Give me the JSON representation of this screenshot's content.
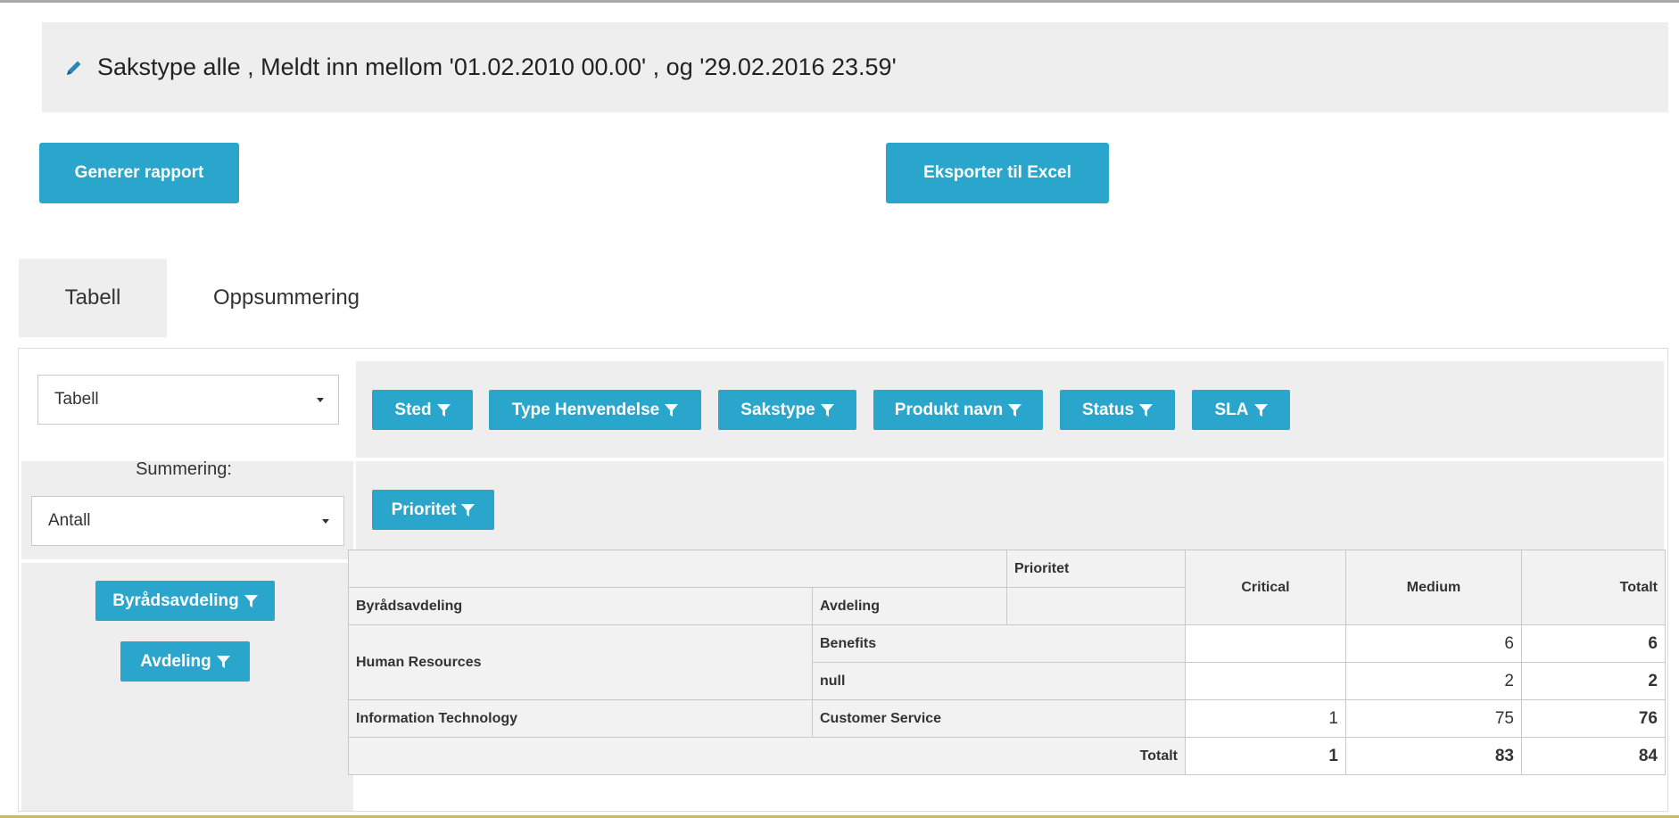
{
  "filter": {
    "text": "Sakstype alle , Meldt inn mellom '01.02.2010 00.00' , og '29.02.2016 23.59'",
    "icon": "pencil-icon"
  },
  "actions": {
    "generate_label": "Generer rapport",
    "export_label": "Eksporter til Excel"
  },
  "tabs": [
    {
      "label": "Tabell",
      "active": true
    },
    {
      "label": "Oppsummering",
      "active": false
    }
  ],
  "pivot": {
    "renderer_select": "Tabell",
    "aggregator_label": "Summering:",
    "aggregator_select": "Antall",
    "col_attrs": [
      "Sted",
      "Type Henvendelse",
      "Sakstype",
      "Produkt navn",
      "Status",
      "SLA"
    ],
    "row_col_attr": "Prioritet",
    "row_attrs": [
      "Byrådsavdeling",
      "Avdeling"
    ]
  },
  "table": {
    "col_header_attr": "Prioritet",
    "row_header_attrs": [
      "Byrådsavdeling",
      "Avdeling"
    ],
    "col_keys": [
      "Critical",
      "Medium"
    ],
    "total_label": "Totalt",
    "rows": [
      {
        "group": "Human Resources",
        "sub": "Benefits",
        "critical": "",
        "medium": "6",
        "total": "6"
      },
      {
        "group": "",
        "sub": "null",
        "critical": "",
        "medium": "2",
        "total": "2"
      },
      {
        "group": "Information Technology",
        "sub": "Customer Service",
        "critical": "1",
        "medium": "75",
        "total": "76"
      }
    ],
    "totals": {
      "critical": "1",
      "medium": "83",
      "total": "84"
    }
  },
  "colors": {
    "accent": "#2aa5cc",
    "panel_bg": "#eeeeee"
  }
}
